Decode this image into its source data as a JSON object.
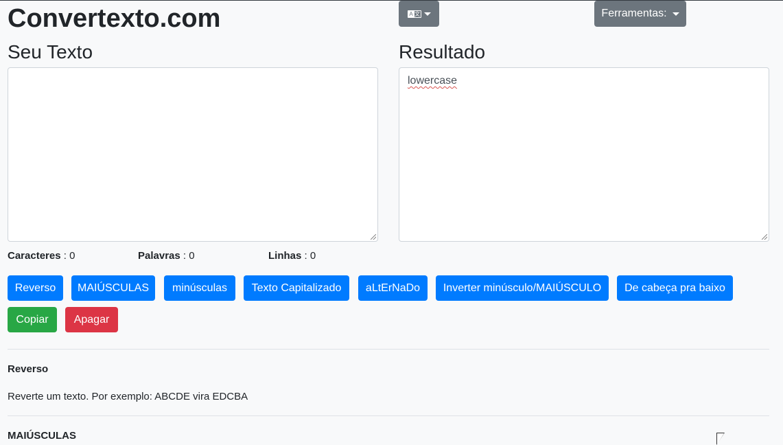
{
  "site": {
    "title": "Convertexto.com"
  },
  "header": {
    "language_icon_left": "A",
    "language_icon_right": "文",
    "tools_label": "Ferramentas:"
  },
  "input": {
    "heading": "Seu Texto",
    "value": ""
  },
  "output": {
    "heading": "Resultado",
    "value": "lowercase"
  },
  "stats": [
    {
      "label": "Caracteres",
      "value": ": 0"
    },
    {
      "label": "Palavras",
      "value": ": 0"
    },
    {
      "label": "Linhas",
      "value": ": 0"
    }
  ],
  "actions": {
    "reverse": "Reverso",
    "upper": "MAIÚSCULAS",
    "lower": "minúsculas",
    "capitalize": "Texto Capitalizado",
    "alternate": "aLtErNaDo",
    "invert": "Inverter minúsculo/MAIÚSCULO",
    "upside_down": "De cabeça pra baixo",
    "copy": "Copiar",
    "clear": "Apagar"
  },
  "descriptions": [
    {
      "title": "Reverso",
      "text": "Reverte um texto. Por exemplo: ABCDE vira EDCBA"
    },
    {
      "title": "MAIÚSCULAS",
      "text": ""
    }
  ],
  "colors": {
    "primary": "#007bff",
    "success": "#28a745",
    "danger": "#dc3545",
    "secondary": "#6c757d"
  }
}
